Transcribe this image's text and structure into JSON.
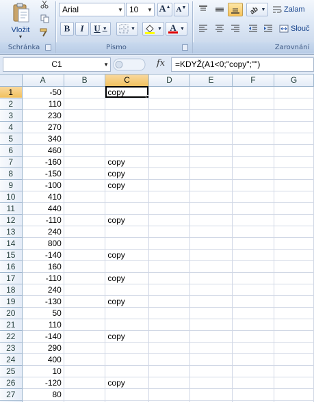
{
  "ribbon": {
    "clipboard": {
      "paste_label": "Vložit",
      "group_label": "Schránka",
      "icons": [
        "paste-icon",
        "cut-icon",
        "copy-icon",
        "format-painter-icon"
      ]
    },
    "font": {
      "group_label": "Písmo",
      "font_name": "Arial",
      "font_size": "10",
      "grow_label": "A",
      "shrink_label": "A",
      "bold_label": "B",
      "italic_label": "I",
      "underline_label": "U",
      "font_color_label": "A",
      "font_color": "#e00000",
      "fill_color": "#ffff00"
    },
    "alignment": {
      "group_label": "Zarovnání",
      "wrap_label": "Zalam",
      "merge_label": "Slouč"
    }
  },
  "formula_bar": {
    "name_box": "C1",
    "fx_label": "fx",
    "formula": "=KDYŽ(A1<0;\"copy\";\"\")"
  },
  "grid": {
    "columns": [
      "A",
      "B",
      "C",
      "D",
      "E",
      "F",
      "G"
    ],
    "selected_column": "C",
    "selected_row": 1,
    "rows": [
      {
        "row": "1",
        "a": "-50",
        "c": "copy"
      },
      {
        "row": "2",
        "a": "110",
        "c": ""
      },
      {
        "row": "3",
        "a": "230",
        "c": ""
      },
      {
        "row": "4",
        "a": "270",
        "c": ""
      },
      {
        "row": "5",
        "a": "340",
        "c": ""
      },
      {
        "row": "6",
        "a": "460",
        "c": ""
      },
      {
        "row": "7",
        "a": "-160",
        "c": "copy"
      },
      {
        "row": "8",
        "a": "-150",
        "c": "copy"
      },
      {
        "row": "9",
        "a": "-100",
        "c": "copy"
      },
      {
        "row": "10",
        "a": "410",
        "c": ""
      },
      {
        "row": "11",
        "a": "440",
        "c": ""
      },
      {
        "row": "12",
        "a": "-110",
        "c": "copy"
      },
      {
        "row": "13",
        "a": "240",
        "c": ""
      },
      {
        "row": "14",
        "a": "800",
        "c": ""
      },
      {
        "row": "15",
        "a": "-140",
        "c": "copy"
      },
      {
        "row": "16",
        "a": "160",
        "c": ""
      },
      {
        "row": "17",
        "a": "-110",
        "c": "copy"
      },
      {
        "row": "18",
        "a": "240",
        "c": ""
      },
      {
        "row": "19",
        "a": "-130",
        "c": "copy"
      },
      {
        "row": "20",
        "a": "50",
        "c": ""
      },
      {
        "row": "21",
        "a": "110",
        "c": ""
      },
      {
        "row": "22",
        "a": "-140",
        "c": "copy"
      },
      {
        "row": "23",
        "a": "290",
        "c": ""
      },
      {
        "row": "24",
        "a": "400",
        "c": ""
      },
      {
        "row": "25",
        "a": "10",
        "c": ""
      },
      {
        "row": "26",
        "a": "-120",
        "c": "copy"
      },
      {
        "row": "27",
        "a": "80",
        "c": ""
      },
      {
        "row": "28",
        "a": "",
        "c": ""
      }
    ]
  }
}
